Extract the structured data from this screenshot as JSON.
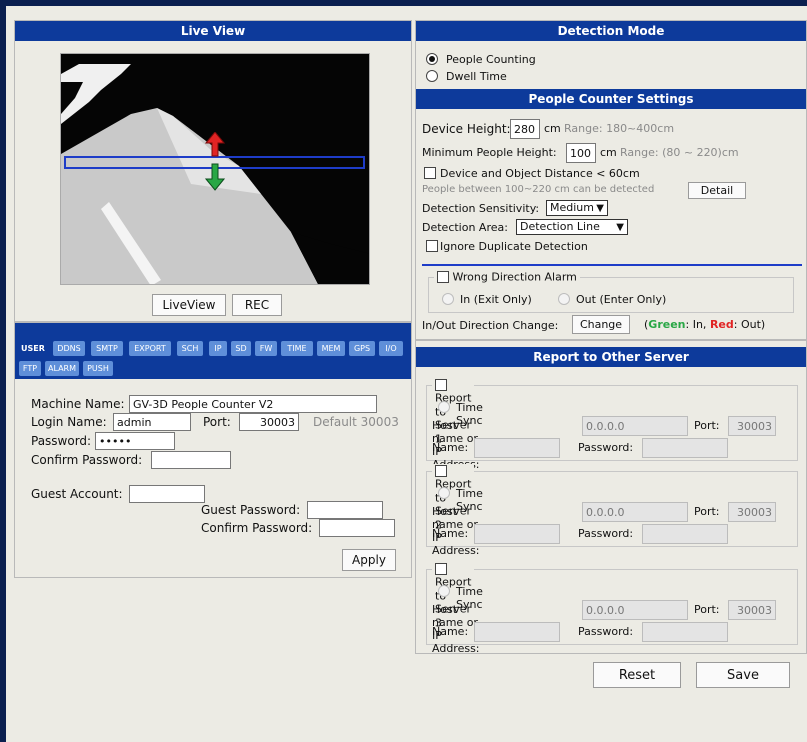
{
  "live_view": {
    "title": "Live View",
    "liveview_button": "LiveView",
    "rec_button": "REC"
  },
  "tabs": [
    "USER",
    "DDNS",
    "SMTP",
    "EXPORT",
    "SCH",
    "IP",
    "SD",
    "FW",
    "TIME",
    "MEM",
    "GPS",
    "I/O",
    "FTP",
    "ALARM",
    "PUSH"
  ],
  "user": {
    "machine_name_label": "Machine Name:",
    "machine_name_value": "GV-3D People Counter V2",
    "login_label": "Login Name:",
    "login_value": "admin",
    "port_label": "Port:",
    "port_value": "30003",
    "port_default": "Default 30003",
    "password_label": "Password:",
    "password_value": "•••••",
    "confirm_label": "Confirm Password:",
    "guest_label": "Guest Account:",
    "guest_password_label": "Guest Password:",
    "guest_confirm_label": "Confirm Password:",
    "apply_button": "Apply"
  },
  "detection": {
    "title": "Detection Mode",
    "option1": "People Counting",
    "option2": "Dwell Time",
    "selected": "People Counting"
  },
  "settings": {
    "title": "People Counter Settings",
    "height_label": "Device Height:",
    "height_value": "280",
    "height_unit": "cm",
    "height_range": "Range: 180~400cm",
    "min_label": "Minimum People Height:",
    "min_value": "100",
    "min_unit": "cm",
    "min_range": "Range: (80 ~ 220)cm",
    "distance_label": "Device and Object Distance < 60cm",
    "between_text": "People between 100~220 cm can be detected",
    "detail_button": "Detail",
    "sensitivity_label": "Detection Sensitivity:",
    "sensitivity_value": "Medium",
    "area_label": "Detection Area:",
    "area_value": "Detection Line",
    "ignore_label": "Ignore Duplicate Detection",
    "wrong_label": "Wrong Direction Alarm",
    "in_label": "In (Exit Only)",
    "out_label": "Out (Enter Only)",
    "change_label": "In/Out Direction Change:",
    "change_button": "Change",
    "legend_open": "(",
    "legend_green": "Green",
    "legend_in": ": In, ",
    "legend_red": "Red",
    "legend_out": ": Out)"
  },
  "report": {
    "title": "Report to Other Server",
    "time_sync": "Time Sync",
    "host_label": "Host name or IP Address:",
    "port_label": "Port:",
    "name_label": "Name:",
    "password_label": "Password:",
    "servers": [
      {
        "label": "Report to Server 1",
        "host": "0.0.0.0",
        "port": "30003"
      },
      {
        "label": "Report to Server 2",
        "host": "0.0.0.0",
        "port": "30003"
      },
      {
        "label": "Report to Server 3",
        "host": "0.0.0.0",
        "port": "30003"
      }
    ]
  },
  "footer": {
    "reset_button": "Reset",
    "save_button": "Save"
  },
  "colors": {
    "header_blue": "#0d3a9b",
    "tab_blue": "#5f8fd9",
    "arrow_red": "#e02424",
    "arrow_green": "#28a745",
    "detection_line": "#1e3cc8"
  }
}
